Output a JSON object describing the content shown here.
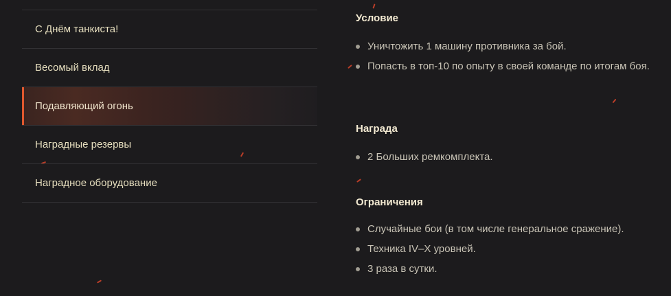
{
  "menu": {
    "items": [
      {
        "label": "С Днём танкиста!"
      },
      {
        "label": "Весомый вклад"
      },
      {
        "label": "Подавляющий огонь"
      },
      {
        "label": "Наградные резервы"
      },
      {
        "label": "Наградное оборудование"
      }
    ]
  },
  "details": {
    "condition": {
      "title": "Условие",
      "items": [
        "Уничтожить 1 машину противника за бой.",
        "Попасть в топ-10 по опыту в своей команде по итогам боя."
      ]
    },
    "reward": {
      "title": "Награда",
      "items": [
        "2 Больших ремкомплекта."
      ]
    },
    "restrictions": {
      "title": "Ограничения",
      "items": [
        "Случайные бои (в том числе генеральное сражение).",
        "Техника IV–X уровней.",
        "3 раза в сутки."
      ]
    }
  },
  "colors": {
    "background": "#1c1b1d",
    "accent": "#e0582e",
    "menu_text": "#e7dfbf",
    "body_text": "#c9c4b6"
  }
}
